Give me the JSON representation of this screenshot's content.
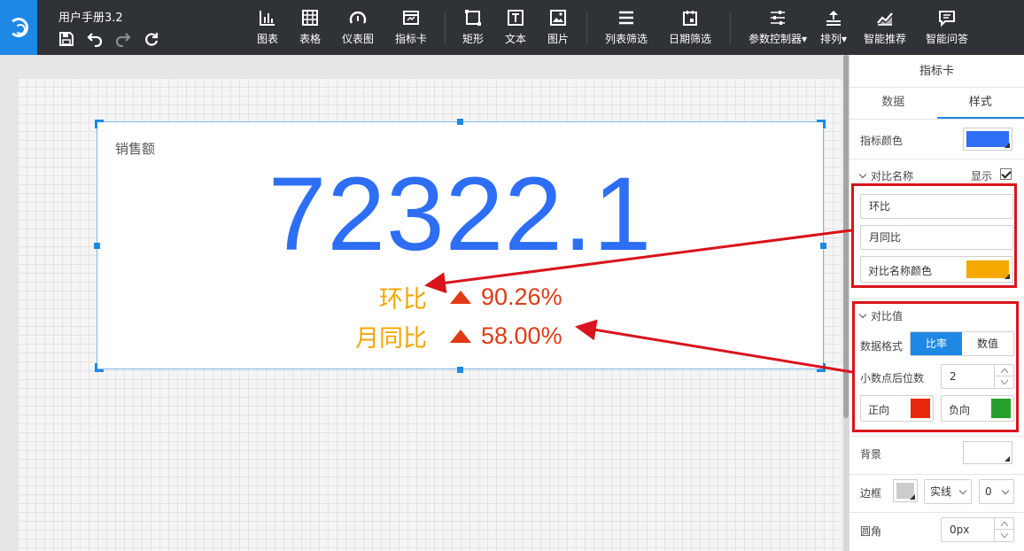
{
  "app": {
    "doc_title": "用户手册3.2"
  },
  "toolbar": {
    "groups": [
      [
        {
          "label": "图表",
          "icon": "bar-chart-icon"
        },
        {
          "label": "表格",
          "icon": "table-icon"
        },
        {
          "label": "仪表图",
          "icon": "gauge-icon"
        },
        {
          "label": "指标卡",
          "icon": "kpi-card-icon"
        }
      ],
      [
        {
          "label": "矩形",
          "icon": "rectangle-icon"
        },
        {
          "label": "文本",
          "icon": "text-icon"
        },
        {
          "label": "图片",
          "icon": "image-icon"
        }
      ],
      [
        {
          "label": "列表筛选",
          "icon": "list-filter-icon"
        },
        {
          "label": "日期筛选",
          "icon": "calendar-icon"
        }
      ],
      [
        {
          "label": "参数控制器",
          "icon": "sliders-icon",
          "dropdown": true
        },
        {
          "label": "排列",
          "icon": "arrange-icon",
          "dropdown": true
        },
        {
          "label": "智能推荐",
          "icon": "smart-recommend-icon"
        },
        {
          "label": "智能问答",
          "icon": "qa-chat-icon"
        }
      ]
    ]
  },
  "card": {
    "title": "销售额",
    "value": "72322.1",
    "comparisons": [
      {
        "name": "环比",
        "value": "90.26%",
        "direction": "up"
      },
      {
        "name": "月同比",
        "value": "58.00%",
        "direction": "up"
      }
    ],
    "colors": {
      "value": "#2d6ef5",
      "name": "#f5a400",
      "positive": "#e03a16"
    }
  },
  "panel": {
    "title": "指标卡",
    "tabs": [
      "数据",
      "样式"
    ],
    "active_tab": "样式",
    "indicator_color_label": "指标颜色",
    "indicator_color": "#2d6ef5",
    "compare_name_section": "对比名称",
    "show_label": "显示",
    "show_checked": true,
    "name_inputs": [
      "环比",
      "月同比"
    ],
    "name_color_label": "对比名称颜色",
    "name_color": "#f5a800",
    "compare_value_section": "对比值",
    "format_label": "数据格式",
    "format_options": [
      "比率",
      "数值"
    ],
    "format_selected": "比率",
    "decimals_label": "小数点后位数",
    "decimals_value": "2",
    "positive_label": "正向",
    "positive_color": "#e8280c",
    "negative_label": "负向",
    "negative_color": "#25a02a",
    "background_label": "背景",
    "background_color": "#ffffff",
    "border_label": "边框",
    "border_color": "#cccccc",
    "border_style": "实线",
    "border_width": "0",
    "radius_label": "圆角",
    "radius_value": "0px"
  }
}
